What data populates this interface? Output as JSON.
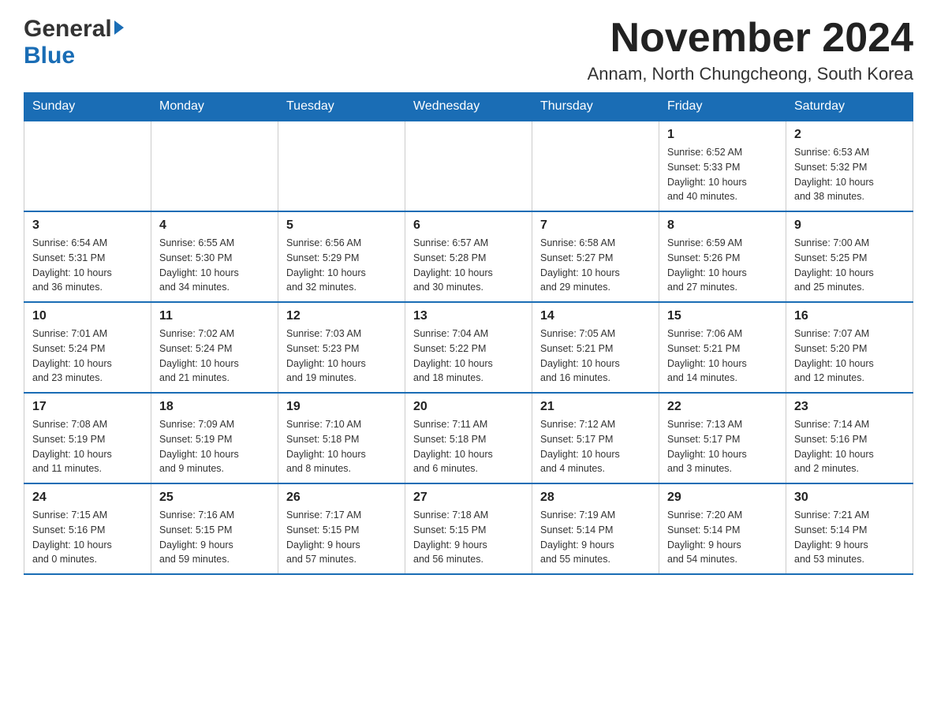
{
  "header": {
    "logo_general": "General",
    "logo_blue": "Blue",
    "month_title": "November 2024",
    "location": "Annam, North Chungcheong, South Korea"
  },
  "weekdays": [
    "Sunday",
    "Monday",
    "Tuesday",
    "Wednesday",
    "Thursday",
    "Friday",
    "Saturday"
  ],
  "weeks": [
    [
      {
        "day": "",
        "info": ""
      },
      {
        "day": "",
        "info": ""
      },
      {
        "day": "",
        "info": ""
      },
      {
        "day": "",
        "info": ""
      },
      {
        "day": "",
        "info": ""
      },
      {
        "day": "1",
        "info": "Sunrise: 6:52 AM\nSunset: 5:33 PM\nDaylight: 10 hours\nand 40 minutes."
      },
      {
        "day": "2",
        "info": "Sunrise: 6:53 AM\nSunset: 5:32 PM\nDaylight: 10 hours\nand 38 minutes."
      }
    ],
    [
      {
        "day": "3",
        "info": "Sunrise: 6:54 AM\nSunset: 5:31 PM\nDaylight: 10 hours\nand 36 minutes."
      },
      {
        "day": "4",
        "info": "Sunrise: 6:55 AM\nSunset: 5:30 PM\nDaylight: 10 hours\nand 34 minutes."
      },
      {
        "day": "5",
        "info": "Sunrise: 6:56 AM\nSunset: 5:29 PM\nDaylight: 10 hours\nand 32 minutes."
      },
      {
        "day": "6",
        "info": "Sunrise: 6:57 AM\nSunset: 5:28 PM\nDaylight: 10 hours\nand 30 minutes."
      },
      {
        "day": "7",
        "info": "Sunrise: 6:58 AM\nSunset: 5:27 PM\nDaylight: 10 hours\nand 29 minutes."
      },
      {
        "day": "8",
        "info": "Sunrise: 6:59 AM\nSunset: 5:26 PM\nDaylight: 10 hours\nand 27 minutes."
      },
      {
        "day": "9",
        "info": "Sunrise: 7:00 AM\nSunset: 5:25 PM\nDaylight: 10 hours\nand 25 minutes."
      }
    ],
    [
      {
        "day": "10",
        "info": "Sunrise: 7:01 AM\nSunset: 5:24 PM\nDaylight: 10 hours\nand 23 minutes."
      },
      {
        "day": "11",
        "info": "Sunrise: 7:02 AM\nSunset: 5:24 PM\nDaylight: 10 hours\nand 21 minutes."
      },
      {
        "day": "12",
        "info": "Sunrise: 7:03 AM\nSunset: 5:23 PM\nDaylight: 10 hours\nand 19 minutes."
      },
      {
        "day": "13",
        "info": "Sunrise: 7:04 AM\nSunset: 5:22 PM\nDaylight: 10 hours\nand 18 minutes."
      },
      {
        "day": "14",
        "info": "Sunrise: 7:05 AM\nSunset: 5:21 PM\nDaylight: 10 hours\nand 16 minutes."
      },
      {
        "day": "15",
        "info": "Sunrise: 7:06 AM\nSunset: 5:21 PM\nDaylight: 10 hours\nand 14 minutes."
      },
      {
        "day": "16",
        "info": "Sunrise: 7:07 AM\nSunset: 5:20 PM\nDaylight: 10 hours\nand 12 minutes."
      }
    ],
    [
      {
        "day": "17",
        "info": "Sunrise: 7:08 AM\nSunset: 5:19 PM\nDaylight: 10 hours\nand 11 minutes."
      },
      {
        "day": "18",
        "info": "Sunrise: 7:09 AM\nSunset: 5:19 PM\nDaylight: 10 hours\nand 9 minutes."
      },
      {
        "day": "19",
        "info": "Sunrise: 7:10 AM\nSunset: 5:18 PM\nDaylight: 10 hours\nand 8 minutes."
      },
      {
        "day": "20",
        "info": "Sunrise: 7:11 AM\nSunset: 5:18 PM\nDaylight: 10 hours\nand 6 minutes."
      },
      {
        "day": "21",
        "info": "Sunrise: 7:12 AM\nSunset: 5:17 PM\nDaylight: 10 hours\nand 4 minutes."
      },
      {
        "day": "22",
        "info": "Sunrise: 7:13 AM\nSunset: 5:17 PM\nDaylight: 10 hours\nand 3 minutes."
      },
      {
        "day": "23",
        "info": "Sunrise: 7:14 AM\nSunset: 5:16 PM\nDaylight: 10 hours\nand 2 minutes."
      }
    ],
    [
      {
        "day": "24",
        "info": "Sunrise: 7:15 AM\nSunset: 5:16 PM\nDaylight: 10 hours\nand 0 minutes."
      },
      {
        "day": "25",
        "info": "Sunrise: 7:16 AM\nSunset: 5:15 PM\nDaylight: 9 hours\nand 59 minutes."
      },
      {
        "day": "26",
        "info": "Sunrise: 7:17 AM\nSunset: 5:15 PM\nDaylight: 9 hours\nand 57 minutes."
      },
      {
        "day": "27",
        "info": "Sunrise: 7:18 AM\nSunset: 5:15 PM\nDaylight: 9 hours\nand 56 minutes."
      },
      {
        "day": "28",
        "info": "Sunrise: 7:19 AM\nSunset: 5:14 PM\nDaylight: 9 hours\nand 55 minutes."
      },
      {
        "day": "29",
        "info": "Sunrise: 7:20 AM\nSunset: 5:14 PM\nDaylight: 9 hours\nand 54 minutes."
      },
      {
        "day": "30",
        "info": "Sunrise: 7:21 AM\nSunset: 5:14 PM\nDaylight: 9 hours\nand 53 minutes."
      }
    ]
  ]
}
